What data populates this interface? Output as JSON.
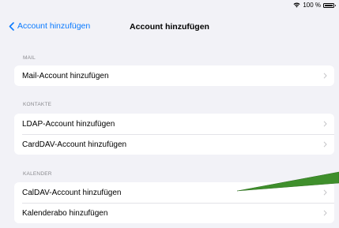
{
  "status_bar": {
    "battery_text": "100 %",
    "wifi_icon": "wifi-icon",
    "battery_icon": "battery-icon"
  },
  "nav": {
    "back_label": "Account hinzufügen",
    "title": "Account hinzufügen",
    "back_icon": "chevron-left-icon"
  },
  "sections": [
    {
      "header": "MAIL",
      "items": [
        {
          "label": "Mail-Account hinzufügen"
        }
      ]
    },
    {
      "header": "KONTAKTE",
      "items": [
        {
          "label": "LDAP-Account hinzufügen"
        },
        {
          "label": "CardDAV-Account hinzufügen"
        }
      ]
    },
    {
      "header": "KALENDER",
      "items": [
        {
          "label": "CalDAV-Account hinzufügen"
        },
        {
          "label": "Kalenderabo hinzufügen"
        }
      ]
    }
  ],
  "colors": {
    "accent": "#0a7aff",
    "background": "#f2f2f7",
    "annotation_arrow": "#3f8f2c"
  }
}
